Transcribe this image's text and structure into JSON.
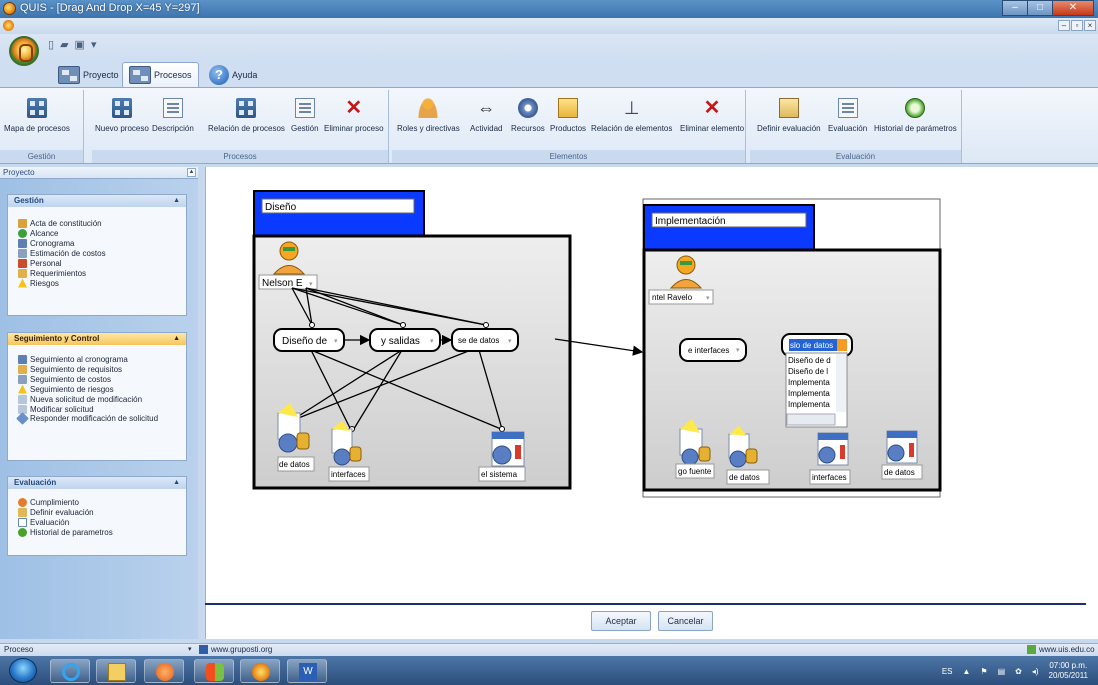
{
  "window": {
    "title": "QUIS - [Drag And Drop  X=45   Y=297]"
  },
  "ribbon_tabs": [
    {
      "label": "Proyecto"
    },
    {
      "label": "Procesos"
    },
    {
      "label": "Ayuda"
    }
  ],
  "ribbon": {
    "gestion": {
      "label": "Gestión",
      "buttons": [
        "Mapa de procesos"
      ]
    },
    "procesos": {
      "label": "Procesos",
      "buttons": [
        "Nuevo proceso",
        "Descripción",
        "Relación de procesos",
        "Gestión",
        "Eliminar proceso"
      ]
    },
    "elementos": {
      "label": "Elementos",
      "buttons": [
        "Roles y directivas",
        "Actividad",
        "Recursos",
        "Productos",
        "Relación de elementos",
        "Eliminar elemento"
      ]
    },
    "evaluacion": {
      "label": "Evaluación",
      "buttons": [
        "Definir evaluación",
        "Evaluación",
        "Historial de parámetros"
      ]
    }
  },
  "panel": {
    "title": "Proyecto",
    "sections": [
      {
        "title": "Gestión",
        "items": [
          "Acta de constitución",
          "Alcance",
          "Cronograma",
          "Estimación de costos",
          "Personal",
          "Requerimientos",
          "Riesgos"
        ]
      },
      {
        "title": "Seguimiento y Control",
        "items": [
          "Seguimiento al cronograma",
          "Seguimiento de requisitos",
          "Seguimiento de costos",
          "Seguimiento de riesgos",
          "Nueva solicitud de modificación",
          "Modificar solicitud",
          "Responder modificación de solicitud"
        ]
      },
      {
        "title": "Evaluación",
        "items": [
          "Cumplimiento",
          "Definir evaluación",
          "Evaluación",
          "Historial de parametros"
        ]
      }
    ]
  },
  "diagram": {
    "proc1": {
      "name": "Diseño",
      "role": "Nelson E",
      "activities": [
        "Diseño de",
        "y salidas",
        "se de datos"
      ],
      "products": [
        "de datos",
        "interfaces",
        "el sistema"
      ]
    },
    "proc2": {
      "name": "Implementación",
      "role": "ntel Ravelo",
      "activities": [
        "e interfaces",
        "slo de datos"
      ],
      "dropdown_options": [
        "Diseño de d",
        "Diseño de l",
        "Implementa",
        "Implementa",
        "Implementa"
      ],
      "products": [
        "go fuente",
        "de datos",
        "interfaces",
        "de datos"
      ]
    }
  },
  "dialog": {
    "accept": "Aceptar",
    "cancel": "Cancelar"
  },
  "statusbar": {
    "left": "Proceso",
    "url": "www.gruposti.org",
    "right": "www.uis.edu.co"
  },
  "tray": {
    "lang": "ES",
    "time": "07:00 p.m.",
    "date": "20/05/2011"
  },
  "colors": {
    "accent_blue": "#0a39ff",
    "process_border": "#000000",
    "selected_orange": "#f59a23"
  }
}
